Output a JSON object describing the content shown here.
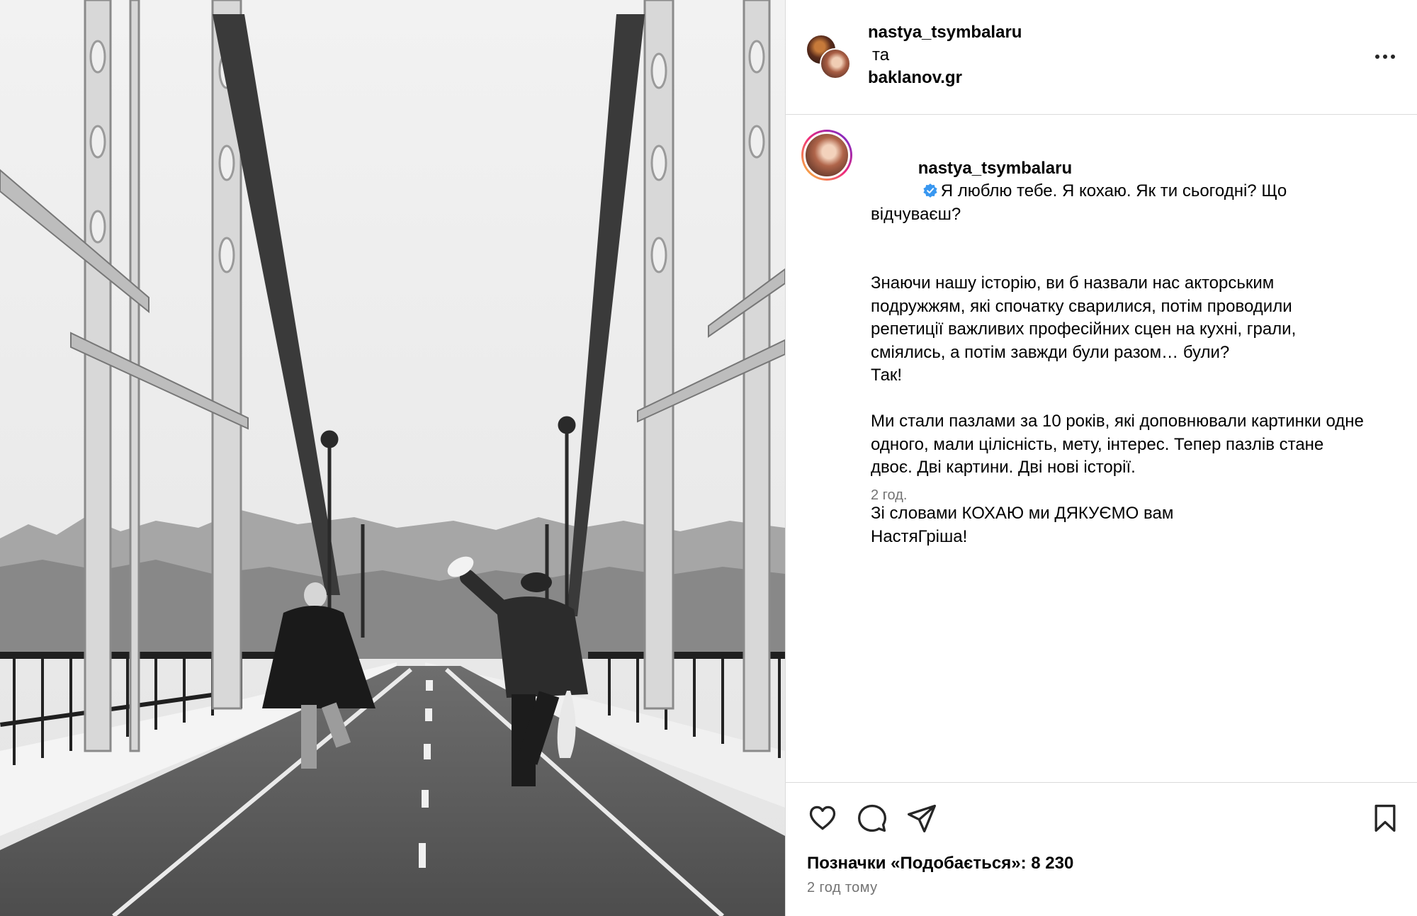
{
  "photo": {
    "alt_icon": "photo-bridge-couple-running"
  },
  "header": {
    "user1": "nastya_tsymbalaru",
    "joiner": "та",
    "user2": "baklanov.gr",
    "more_icon": "more-horizontal-icon"
  },
  "caption": {
    "username": "nastya_tsymbalaru",
    "verified_icon": "verified-badge-icon",
    "verified_color": "#3897f0",
    "line1": "Я люблю тебе. Я кохаю. Як ти сьогодні? Що відчуваєш?",
    "para2": "Знаючи нашу історію, ви б назвали нас акторським подружжям, які спочатку сварилися, потім проводили репетиції важливих професійних сцен на кухні, грали, сміялись, а потім завжди були разом… були?\nТак!",
    "para3": "Ми стали пазлами за 10 років, які доповнювали картинки одне одного, мали цілісність, мету, інтерес. Тепер пазлів стане двоє. Дві картини. Дві нові історії.",
    "para4": "Зі словами КОХАЮ ми ДЯКУЄМО вам\nНастяГріша!",
    "time": "2 год."
  },
  "actions": {
    "like_icon": "heart-icon",
    "comment_icon": "comment-icon",
    "share_icon": "paper-plane-icon",
    "save_icon": "bookmark-icon",
    "likes_text": "Позначки «Подобається»: 8 230",
    "posted_ago": "2 год тому"
  }
}
